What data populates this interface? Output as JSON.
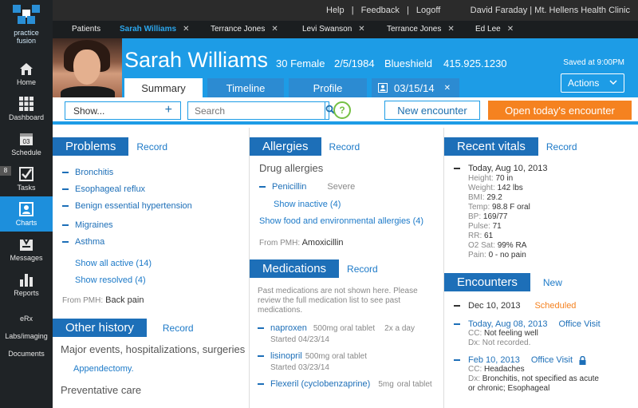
{
  "app": {
    "logo_line1": "practice",
    "logo_line2": "fusion"
  },
  "sidebar": {
    "items": [
      {
        "label": "Home",
        "icon": "home-icon"
      },
      {
        "label": "Dashboard",
        "icon": "grid-icon"
      },
      {
        "label": "Schedule",
        "icon": "calendar-icon",
        "date": "03"
      },
      {
        "label": "Tasks",
        "icon": "checkbox-icon",
        "badge": "8"
      },
      {
        "label": "Charts",
        "icon": "person-icon"
      },
      {
        "label": "Messages",
        "icon": "inbox-icon"
      },
      {
        "label": "Reports",
        "icon": "bar-chart-icon"
      }
    ],
    "text_items": [
      "eRx",
      "Labs/imaging",
      "Documents"
    ],
    "active": "Charts"
  },
  "topbar": {
    "help": "Help",
    "sep1": "|",
    "feedback": "Feedback",
    "sep2": "|",
    "logoff": "Logoff",
    "user": "David Faraday | Mt. Hellens Health Clinic"
  },
  "patient_tabs": {
    "patients_label": "Patients",
    "tabs": [
      {
        "label": "Sarah Williams",
        "active": true
      },
      {
        "label": "Terrance Jones",
        "active": false
      },
      {
        "label": "Levi Swanson",
        "active": false
      },
      {
        "label": "Terrance Jones",
        "active": false
      },
      {
        "label": "Ed Lee",
        "active": false
      }
    ],
    "close_glyph": "✕"
  },
  "header": {
    "name": "Sarah Williams",
    "age_sex": "30 Female",
    "dob": "2/5/1984",
    "insurance": "Blueshield",
    "phone": "415.925.1230",
    "saved": "Saved at 9:00PM",
    "actions_label": "Actions",
    "tabs": [
      "Summary",
      "Timeline",
      "Profile"
    ],
    "encounter_tab": "03/15/14",
    "active_tab": "Summary"
  },
  "toolbar": {
    "show_label": "Show...",
    "search_placeholder": "Search",
    "help_glyph": "?",
    "new_encounter": "New encounter",
    "open_today": "Open today's encounter"
  },
  "problems": {
    "title": "Problems",
    "record": "Record",
    "items": [
      "Bronchitis",
      "Esophageal reflux",
      "Benign essential hypertension",
      "Migraines",
      "Asthma"
    ],
    "show_all_active": "Show all active (14)",
    "show_resolved": "Show resolved (4)",
    "from_pmh_label": "From PMH:",
    "from_pmh_value": "Back pain"
  },
  "other_history": {
    "title": "Other history",
    "record": "Record",
    "major_label": "Major events, hospitalizations, surgeries",
    "major_item": "Appendectomy.",
    "preventative_label": "Preventative care"
  },
  "allergies": {
    "title": "Allergies",
    "record": "Record",
    "drug_label": "Drug allergies",
    "drug_item": "Penicillin",
    "drug_severity": "Severe",
    "show_inactive": "Show inactive (4)",
    "show_food": "Show food and environmental allergies (4)",
    "from_pmh_label": "From PMH:",
    "from_pmh_value": "Amoxicillin"
  },
  "medications": {
    "title": "Medications",
    "record": "Record",
    "note": "Past medications are not shown here. Please review the full medication list to see past medications.",
    "items": [
      {
        "name": "naproxen",
        "dose": "500mg oral tablet",
        "freq": "2x a day",
        "started": "Started 04/23/14"
      },
      {
        "name": "lisinopril",
        "dose": "500mg oral tablet",
        "freq": "",
        "started": "Started 03/23/14"
      },
      {
        "name": "Flexeril (cyclobenzaprine)",
        "dose": "5mg",
        "freq": "oral tablet",
        "started": ""
      }
    ]
  },
  "vitals": {
    "title": "Recent vitals",
    "record": "Record",
    "date": "Today, Aug 10, 2013",
    "rows": [
      {
        "label": "Height:",
        "value": "70 in"
      },
      {
        "label": "Weight:",
        "value": "142 lbs"
      },
      {
        "label": "BMI:",
        "value": "29.2"
      },
      {
        "label": "Temp:",
        "value": "98.8 F oral"
      },
      {
        "label": "BP:",
        "value": "169/77"
      },
      {
        "label": "Pulse:",
        "value": "71"
      },
      {
        "label": "RR:",
        "value": "61"
      },
      {
        "label": "O2 Sat:",
        "value": "99% RA"
      },
      {
        "label": "Pain:",
        "value": "0 - no pain"
      }
    ]
  },
  "encounters": {
    "title": "Encounters",
    "new": "New",
    "items": [
      {
        "date": "Dec 10, 2013",
        "status": "Scheduled"
      },
      {
        "date": "Today, Aug 08, 2013",
        "type": "Office Visit",
        "cc_label": "CC:",
        "cc": "Not feeling well",
        "dx_label": "Dx:",
        "dx": "Not recorded."
      },
      {
        "date": "Feb 10, 2013",
        "type": "Office Visit",
        "cc_label": "CC:",
        "cc": "Headaches",
        "dx_label": "Dx:",
        "dx": "Bronchitis, not specified as acute or chronic; Esophageal"
      }
    ]
  },
  "colors": {
    "brand_blue": "#1d9ce6",
    "section_blue": "#1d6fb8",
    "orange": "#f58220",
    "green": "#75c044",
    "sidebar": "#1f2326"
  }
}
